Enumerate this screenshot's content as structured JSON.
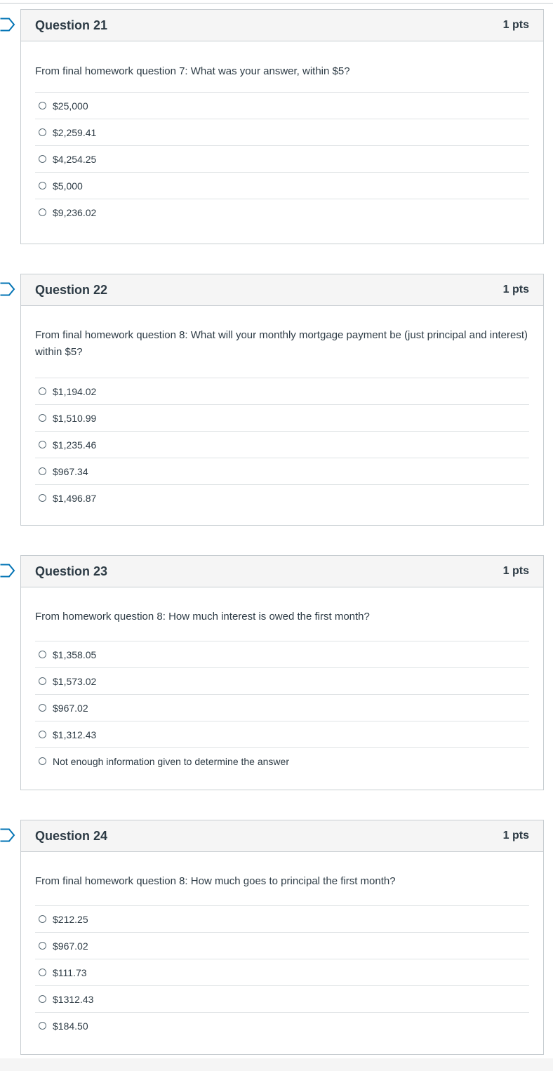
{
  "questions": [
    {
      "title": "Question 21",
      "points": "1 pts",
      "text": "From final homework question 7: What was your answer, within $5?",
      "answers": [
        "$25,000",
        "$2,259.41",
        "$4,254.25",
        "$5,000",
        "$9,236.02"
      ]
    },
    {
      "title": "Question 22",
      "points": "1 pts",
      "text": "From final homework question 8: What will your monthly mortgage payment be (just principal and interest) within $5?",
      "answers": [
        "$1,194.02",
        "$1,510.99",
        "$1,235.46",
        "$967.34",
        "$1,496.87"
      ]
    },
    {
      "title": "Question 23",
      "points": "1 pts",
      "text": "From homework question 8: How much interest is owed the first month?",
      "answers": [
        "$1,358.05",
        "$1,573.02",
        "$967.02",
        "$1,312.43",
        "Not enough information given to determine the answer"
      ]
    },
    {
      "title": "Question 24",
      "points": "1 pts",
      "text": "From final homework question 8: How much goes to principal the first month?",
      "answers": [
        "$212.25",
        "$967.02",
        "$111.73",
        "$1312.43",
        "$184.50"
      ]
    }
  ],
  "colors": {
    "flag": "#0374b5",
    "header_bg": "#f5f5f5",
    "border": "#c7cdd1",
    "text": "#2d3b45"
  },
  "icons": {
    "flag": "flag-question-icon",
    "radio": "radio-button-icon"
  }
}
